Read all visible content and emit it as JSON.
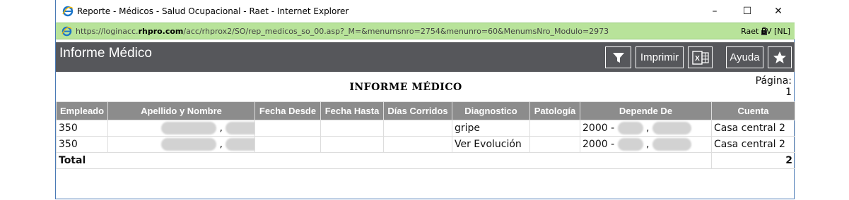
{
  "window": {
    "title": "Reporte - Médicos - Salud Ocupacional - Raet - Internet Explorer",
    "minimize": "–",
    "maximize": "☐",
    "close": "✕"
  },
  "address": {
    "url_prefix": "https://loginacc.",
    "url_domain": "rhpro.com",
    "url_rest": "/acc/rhprox2/SO/rep_medicos_so_00.asp?_M=&menumsnro=2754&menunro=60&MenumsNro_Modulo=2973",
    "certificate": "Raet BV [NL]"
  },
  "header": {
    "title": "Informe Médico",
    "print_label": "Imprimir",
    "help_label": "Ayuda"
  },
  "report": {
    "title": "INFORME MÉDICO",
    "page_label": "Página:",
    "page_number": "1",
    "columns": [
      "Empleado",
      "Apellido y Nombre",
      "Fecha Desde",
      "Fecha Hasta",
      "Días Corridos",
      "Diagnostico",
      "Patología",
      "Depende De",
      "Cuenta"
    ],
    "rows": [
      {
        "empleado": "350",
        "nombre_sep": ",",
        "fecha_desde": "",
        "fecha_hasta": "",
        "dias": "",
        "diagnostico": "gripe",
        "patologia": "",
        "depende_prefix": "2000 -",
        "depende_sep": ",",
        "cuenta": "Casa central 2"
      },
      {
        "empleado": "350",
        "nombre_sep": ",",
        "fecha_desde": "",
        "fecha_hasta": "",
        "dias": "",
        "diagnostico": "Ver Evolución",
        "patologia": "",
        "depende_prefix": "2000 -",
        "depende_sep": ",",
        "cuenta": "Casa central 2"
      }
    ],
    "total_label": "Total",
    "total_value": "2"
  },
  "icons": {
    "filter": "filter-icon",
    "excel": "excel-icon",
    "favorite": "star-icon"
  },
  "colors": {
    "header_bg": "#56575b",
    "table_header_bg": "#8c8c8c",
    "address_bar_bg": "#b8e39a"
  }
}
